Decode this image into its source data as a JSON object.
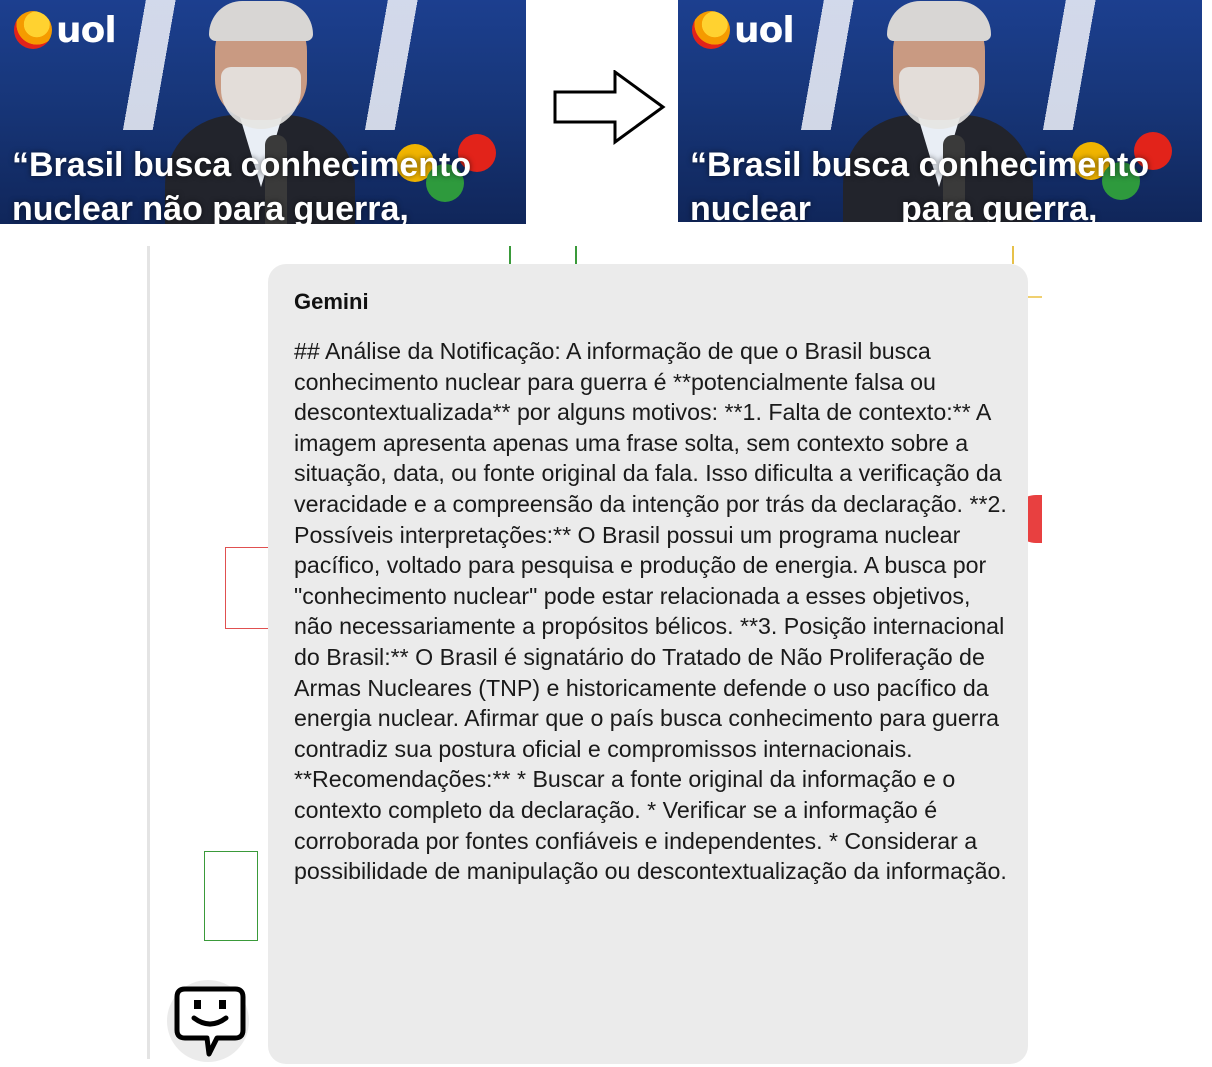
{
  "thumbnails": {
    "logo_text": "uol",
    "left_caption_line1": "“Brasil busca conhecimento",
    "left_caption_line2": "nuclear não para guerra,",
    "right_caption_line1": "“Brasil busca conhecimento",
    "right_caption_line2a": "nuclear",
    "right_caption_line2b": "para guerra,"
  },
  "gemini": {
    "title": "Gemini",
    "body": "## Análise da Notificação: A informação de que o Brasil busca conhecimento nuclear para guerra é **potencialmente falsa ou descontextualizada** por alguns motivos: **1. Falta de contexto:** A imagem apresenta apenas uma frase solta, sem contexto sobre a situação, data, ou fonte original da fala. Isso dificulta a verificação da veracidade e a compreensão da intenção por trás da declaração. **2. Possíveis interpretações:** O Brasil possui um programa nuclear pacífico, voltado para pesquisa e produção de energia. A busca por \"conhecimento nuclear\" pode estar relacionada a esses objetivos, não necessariamente a propósitos bélicos. **3. Posição internacional do Brasil:** O Brasil é signatário do Tratado de Não Proliferação de Armas Nucleares (TNP) e historicamente defende o uso pacífico da energia nuclear. Afirmar que o país busca conhecimento para guerra contradiz sua postura oficial e compromissos internacionais. **Recomendações:** * Buscar a fonte original da informação e o contexto completo da declaração. * Verificar se a informação é corroborada por fontes confiáveis e independentes. * Considerar a possibilidade de manipulação ou descontextualização da informação."
  },
  "icons": {
    "arrow": "right-arrow-icon",
    "avatar": "bot-chat-face-icon",
    "logo": "uol-logo-icon"
  },
  "colors": {
    "card_bg": "#ebebeb",
    "thumb_bg": "#1c3f8f",
    "logo_orange": "#f59b00"
  }
}
